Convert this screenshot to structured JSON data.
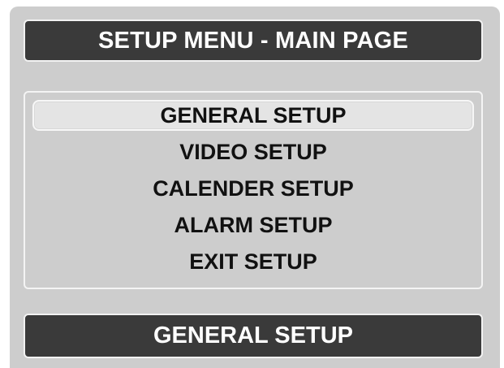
{
  "header": {
    "title": "SETUP MENU - MAIN PAGE"
  },
  "menu": {
    "items": [
      {
        "label": "GENERAL SETUP",
        "selected": true
      },
      {
        "label": "VIDEO SETUP",
        "selected": false
      },
      {
        "label": "CALENDER SETUP",
        "selected": false
      },
      {
        "label": "ALARM SETUP",
        "selected": false
      },
      {
        "label": "EXIT SETUP",
        "selected": false
      }
    ]
  },
  "status": {
    "current_selection": "GENERAL SETUP"
  },
  "colors": {
    "panel_background": "#cdcdcd",
    "bar_background": "#3a3a3a",
    "selection_highlight": "#e4e4e4",
    "menu_text": "#111111",
    "bar_text": "#ffffff"
  }
}
